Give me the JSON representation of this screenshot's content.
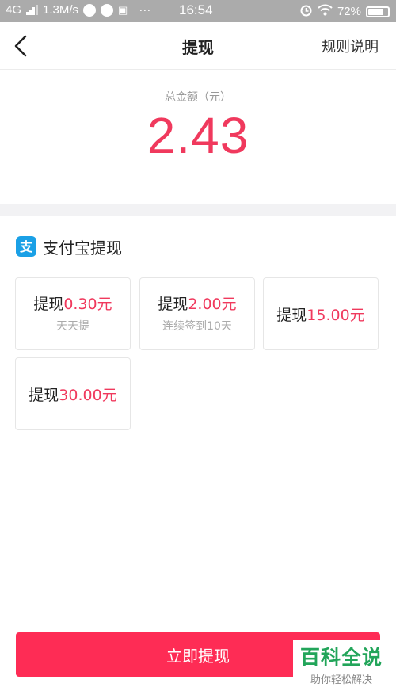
{
  "status_bar": {
    "network": "4G",
    "speed": "1.3M/s",
    "dots": "···",
    "time": "16:54",
    "battery": "72%"
  },
  "nav": {
    "title": "提现",
    "rules_link": "规则说明",
    "back_icon": "back-arrow-icon"
  },
  "balance": {
    "label": "总金额（元）",
    "amount": "2.43",
    "amount_color": "#f0395d"
  },
  "section": {
    "title": "支付宝提现",
    "icon": "alipay-icon"
  },
  "options": [
    {
      "prefix": "提现",
      "amount": "0.30元",
      "note": "天天提"
    },
    {
      "prefix": "提现",
      "amount": "2.00元",
      "note": "连续签到10天"
    },
    {
      "prefix": "提现",
      "amount": "15.00元"
    },
    {
      "prefix": "提现",
      "amount": "30.00元"
    }
  ],
  "action": {
    "label": "立即提现",
    "color": "#fe2c55"
  },
  "watermark": {
    "main": "百科全说",
    "sub": "助你轻松解决"
  }
}
